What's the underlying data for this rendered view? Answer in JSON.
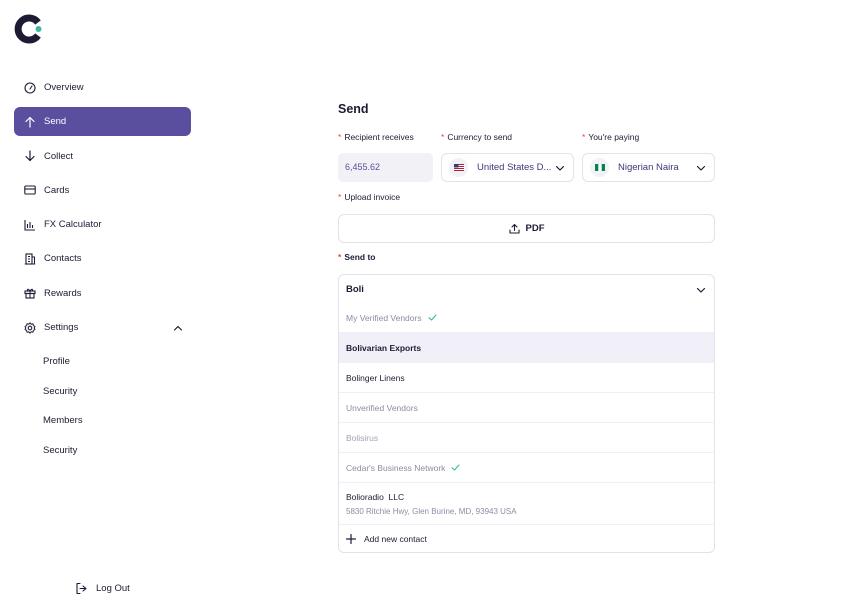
{
  "sidebar": {
    "items": [
      {
        "label": "Overview",
        "icon": "gauge-icon"
      },
      {
        "label": "Send",
        "icon": "arrow-up-icon",
        "active": true
      },
      {
        "label": "Collect",
        "icon": "arrow-down-icon"
      },
      {
        "label": "Cards",
        "icon": "card-icon"
      },
      {
        "label": "FX Calculator",
        "icon": "bar-chart-icon"
      },
      {
        "label": "Contacts",
        "icon": "building-icon"
      },
      {
        "label": "Rewards",
        "icon": "gift-icon"
      },
      {
        "label": "Settings",
        "icon": "gear-icon",
        "expanded": true
      }
    ],
    "settings_sub": [
      "Profile",
      "Security",
      "Members",
      "Security"
    ],
    "logout_label": "Log Out"
  },
  "form": {
    "title": "Send",
    "recipient_label": "Recipient receives",
    "recipient_value": "6,455.62",
    "currency_label": "Currency to send",
    "currency_value": "United States D...",
    "paying_label": "You're paying",
    "paying_value": "Nigerian Naira",
    "upload_label": "Upload invoice",
    "upload_button": "PDF",
    "sendto_label": "Send to",
    "search_value": "Boli",
    "dropdown": {
      "verified_group": "My Verified Vendors",
      "option_1": "Bolivarian Exports",
      "option_2": "Bolinger Linens",
      "unverified_group": "Unverified Vendors",
      "option_3": "Bolisirus",
      "cedar_group": "Cedar's Business Network",
      "option_4_name": "Bolioradio  LLC",
      "option_4_address": "5830 Ritchie Hwy, Glen Burine, MD, 93943 USA",
      "add_contact": "Add new contact"
    }
  },
  "colors": {
    "brand": "#5a4f9e",
    "required": "#e04a4a",
    "verified_check": "#3bb8a0",
    "text_dark": "#1d1b33"
  }
}
